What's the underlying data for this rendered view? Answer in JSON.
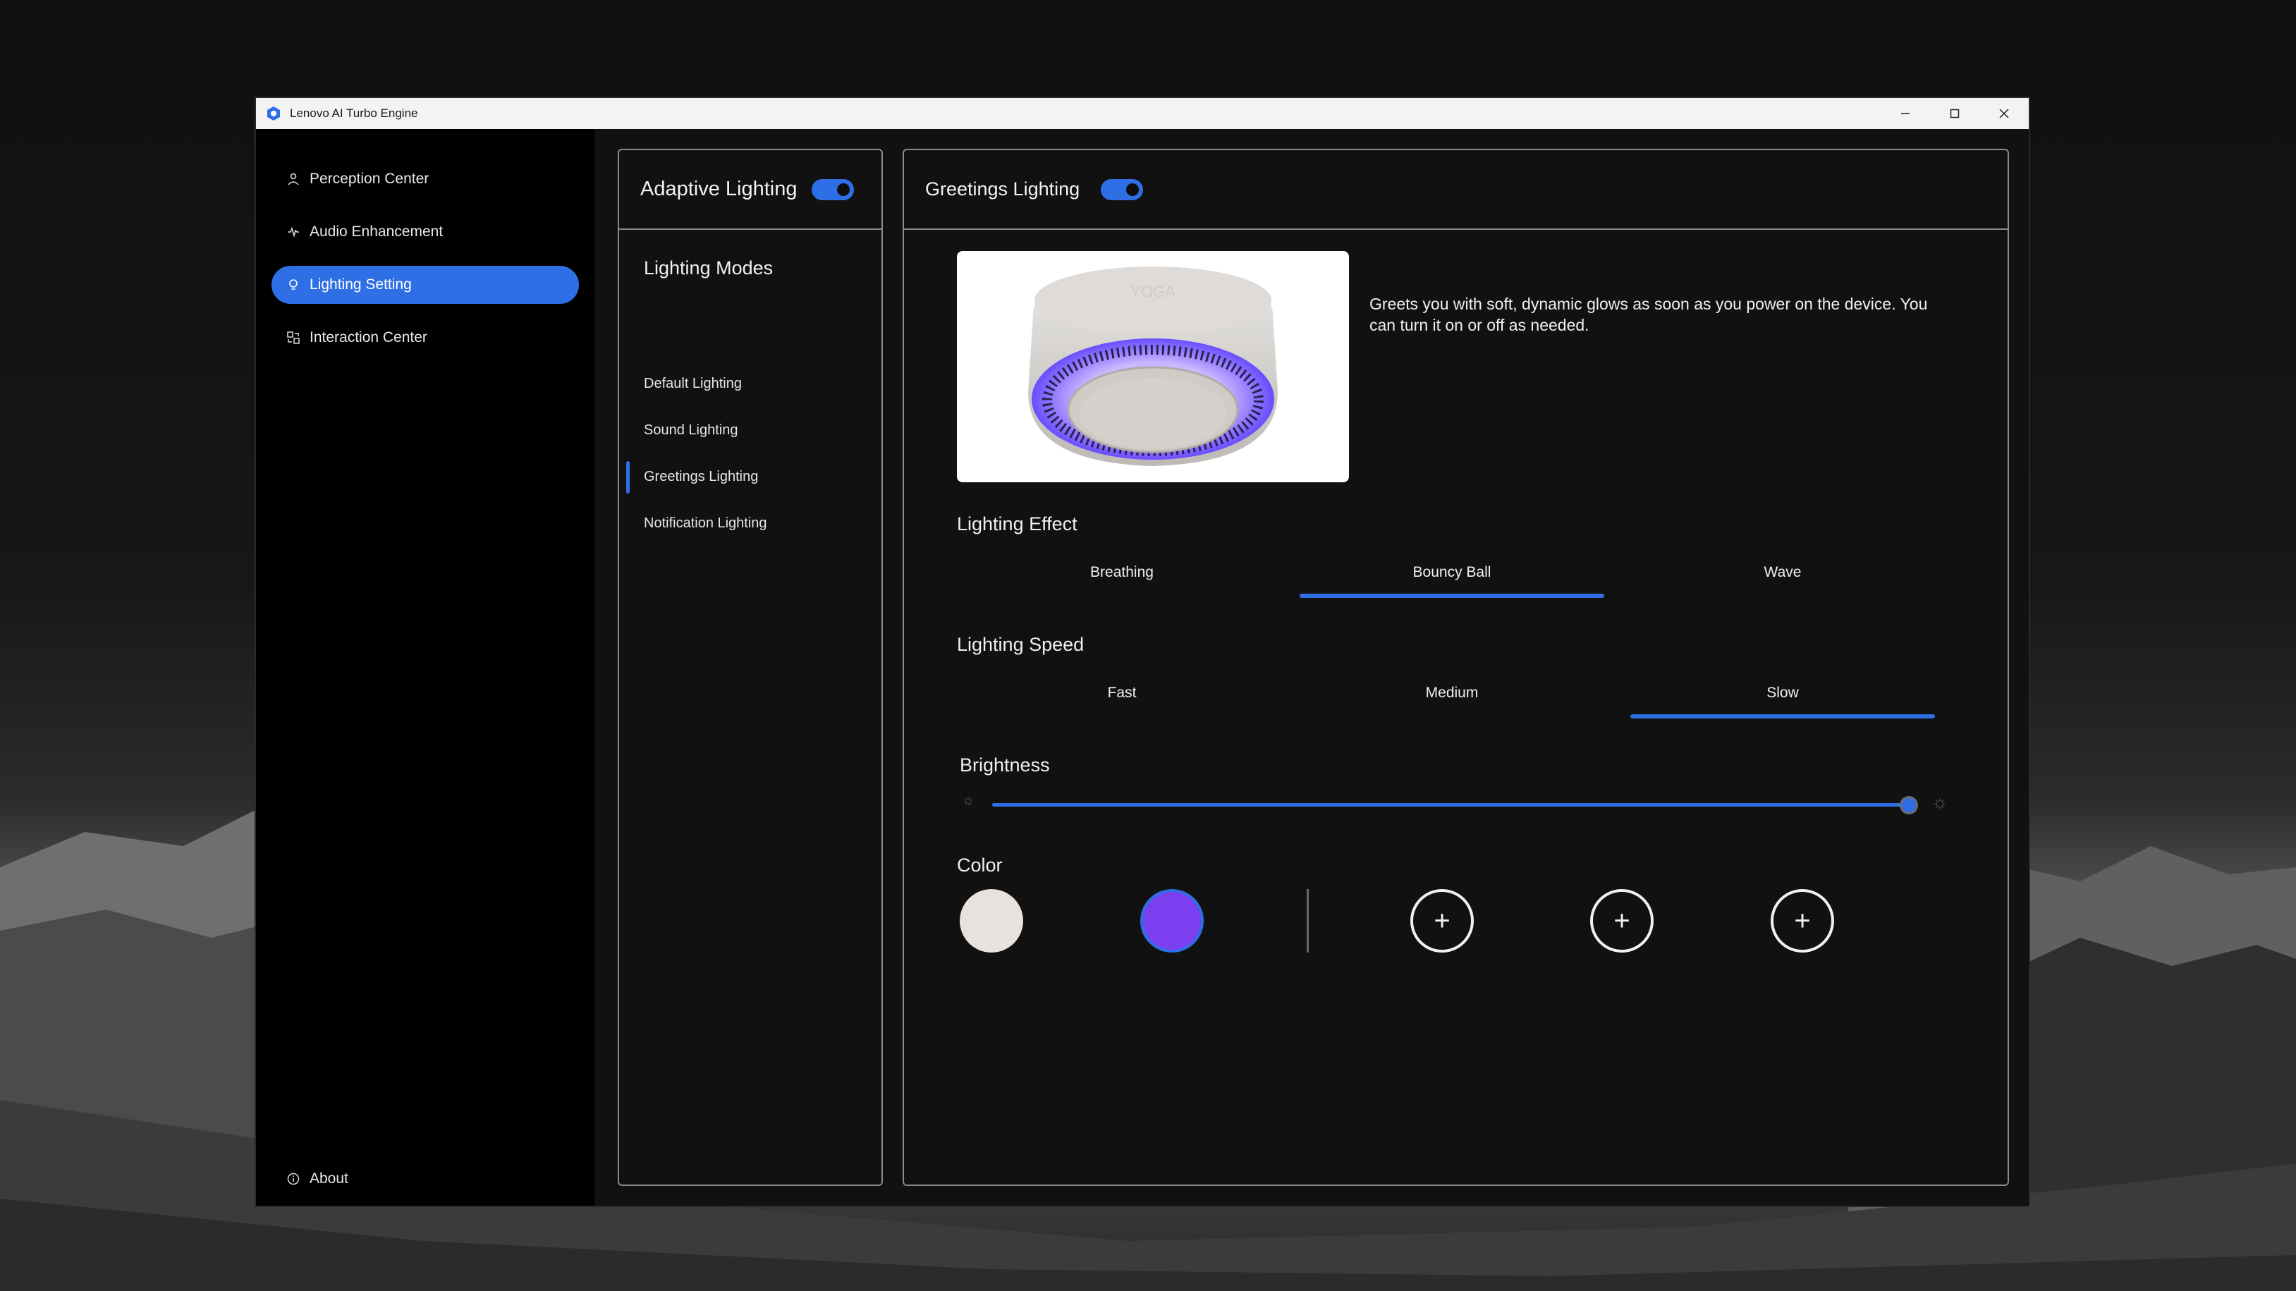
{
  "window": {
    "title": "Lenovo AI Turbo Engine"
  },
  "sidebar": {
    "items": [
      {
        "label": "Perception Center",
        "icon": "person-sensor-icon",
        "active": false
      },
      {
        "label": "Audio Enhancement",
        "icon": "audio-wave-icon",
        "active": false
      },
      {
        "label": "Lighting Setting",
        "icon": "bulb-icon",
        "active": true
      },
      {
        "label": "Interaction Center",
        "icon": "interaction-icon",
        "active": false
      }
    ],
    "about_label": "About"
  },
  "modes_panel": {
    "title": "Adaptive Lighting",
    "toggle_on": true,
    "heading": "Lighting Modes",
    "items": [
      "Default Lighting",
      "Sound Lighting",
      "Greetings Lighting",
      "Notification Lighting"
    ],
    "selected": "Greetings Lighting"
  },
  "detail_panel": {
    "title": "Greetings Lighting",
    "toggle_on": true,
    "description": "Greets you with soft, dynamic glows as soon as you power on the device. You can turn it on or off as needed.",
    "preview_logo": "YOGA",
    "effect": {
      "label": "Lighting Effect",
      "options": [
        "Breathing",
        "Bouncy Ball",
        "Wave"
      ],
      "selected": "Bouncy Ball"
    },
    "speed": {
      "label": "Lighting Speed",
      "options": [
        "Fast",
        "Medium",
        "Slow"
      ],
      "selected": "Slow"
    },
    "brightness": {
      "label": "Brightness",
      "value_fraction": 0.96
    },
    "color": {
      "label": "Color",
      "swatches": [
        "#e7e2dd",
        "#7b3ff0"
      ],
      "add_slots": 3,
      "add_symbol": "+"
    }
  },
  "colors": {
    "accent": "#2f6fe6",
    "window_bg": "#111111",
    "sidebar_bg": "#000000"
  }
}
